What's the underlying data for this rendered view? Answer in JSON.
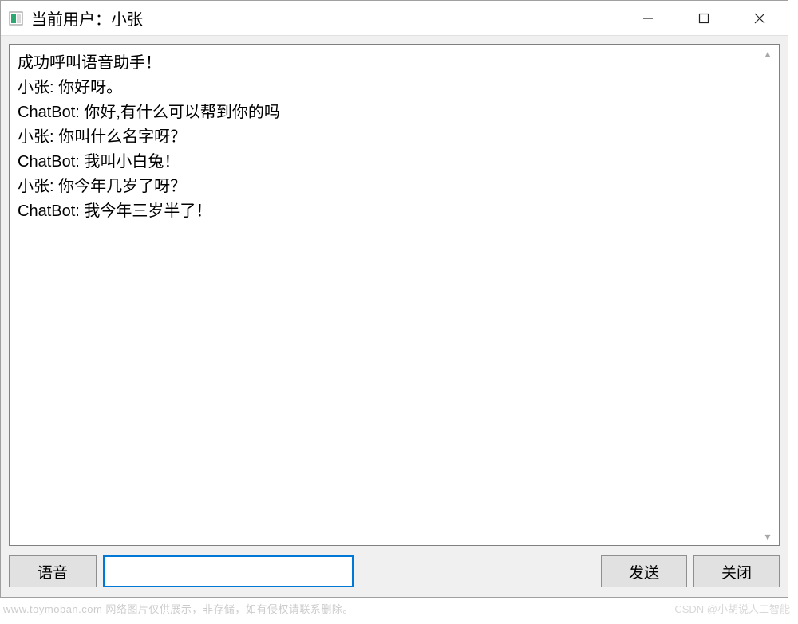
{
  "window": {
    "title": "当前用户：小张"
  },
  "chat": {
    "lines": [
      "成功呼叫语音助手！",
      "小张: 你好呀。",
      "ChatBot: 你好,有什么可以帮到你的吗",
      "小张: 你叫什么名字呀？",
      "ChatBot: 我叫小白兔！",
      "小张: 你今年几岁了呀？",
      "ChatBot: 我今年三岁半了！"
    ]
  },
  "bottom": {
    "voice_label": "语音",
    "input_value": "",
    "input_placeholder": "",
    "send_label": "发送",
    "close_label": "关闭"
  },
  "watermark": {
    "left": "www.toymoban.com  网络图片仅供展示，非存储，如有侵权请联系删除。",
    "right": "CSDN @小胡说人工智能"
  }
}
